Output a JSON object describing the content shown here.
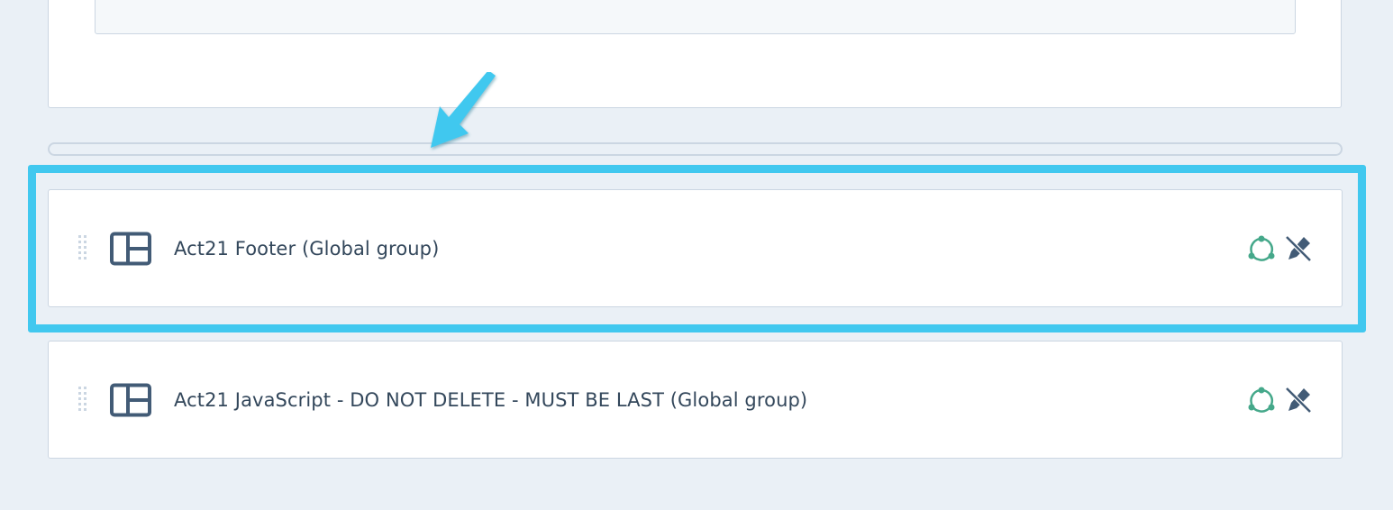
{
  "colors": {
    "background": "#eaf0f6",
    "card": "#ffffff",
    "border": "#cbd6e2",
    "highlight": "#41c8ef",
    "arrow": "#41c8ef",
    "label": "#33475b",
    "global_icon": "#45a88a",
    "edit_icon": "#425b76"
  },
  "modules": [
    {
      "label": "Act21 Footer (Global group)",
      "icon": "layout-icon",
      "status_icon": "global-group-icon",
      "action_icon": "edit-disabled-icon",
      "highlighted": true
    },
    {
      "label": "Act21 JavaScript - DO NOT DELETE - MUST BE LAST (Global group)",
      "icon": "layout-icon",
      "status_icon": "global-group-icon",
      "action_icon": "edit-disabled-icon",
      "highlighted": false
    }
  ]
}
